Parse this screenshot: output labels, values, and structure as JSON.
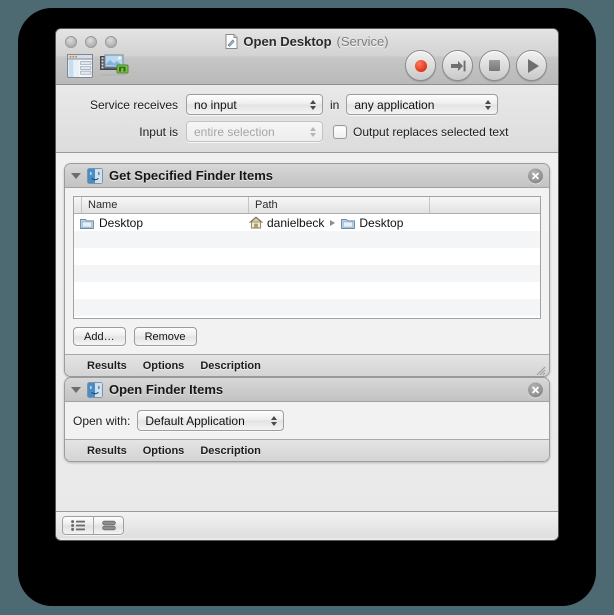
{
  "window": {
    "title": "Open Desktop",
    "title_suffix": "(Service)",
    "title_icon": "workflow-document-icon",
    "traffic_lights": [
      "close",
      "minimize",
      "zoom"
    ]
  },
  "toolbar": {
    "left_buttons": [
      {
        "name": "hide-library-icon",
        "label": "Hide Library"
      },
      {
        "name": "media-browser-icon",
        "label": "Media"
      }
    ],
    "right_buttons": [
      {
        "name": "record-button",
        "label": "Record"
      },
      {
        "name": "step-button",
        "label": "Step"
      },
      {
        "name": "stop-button",
        "label": "Stop"
      },
      {
        "name": "run-button",
        "label": "Run"
      }
    ]
  },
  "settings": {
    "service_receives_label": "Service receives",
    "service_receives_value": "no input",
    "in_label": "in",
    "application_value": "any application",
    "input_is_label": "Input is",
    "input_is_value": "entire selection",
    "input_is_disabled": true,
    "output_replaces_label": "Output replaces selected text",
    "output_replaces_checked": false
  },
  "actions": [
    {
      "title": "Get Specified Finder Items",
      "icon": "finder-icon",
      "expanded": true,
      "table": {
        "columns": [
          "",
          "Name",
          "Path",
          ""
        ],
        "rows": [
          {
            "name": "Desktop",
            "name_icon": "folder-icon",
            "path_parts": [
              {
                "icon": "home-icon",
                "text": "danielbeck"
              },
              {
                "icon": "folder-icon",
                "text": "Desktop"
              }
            ]
          }
        ],
        "empty_rows": 6
      },
      "buttons": [
        "Add…",
        "Remove"
      ],
      "footer_tabs": [
        "Results",
        "Options",
        "Description"
      ]
    },
    {
      "title": "Open Finder Items",
      "icon": "finder-icon",
      "expanded": true,
      "open_with_label": "Open with:",
      "open_with_value": "Default Application",
      "footer_tabs": [
        "Results",
        "Options",
        "Description"
      ]
    }
  ],
  "bottom_bar": {
    "view_buttons": [
      {
        "name": "list-view-icon",
        "label": "List View",
        "selected": false
      },
      {
        "name": "stacked-view-icon",
        "label": "Stacked View",
        "selected": false
      }
    ]
  },
  "colors": {
    "desktop_background": "#4d6a73",
    "window_chrome": "#d3d3d3",
    "canvas": "#eeeeee",
    "record_red": "#e0351a",
    "finder_blue": "#5b9bd5"
  }
}
